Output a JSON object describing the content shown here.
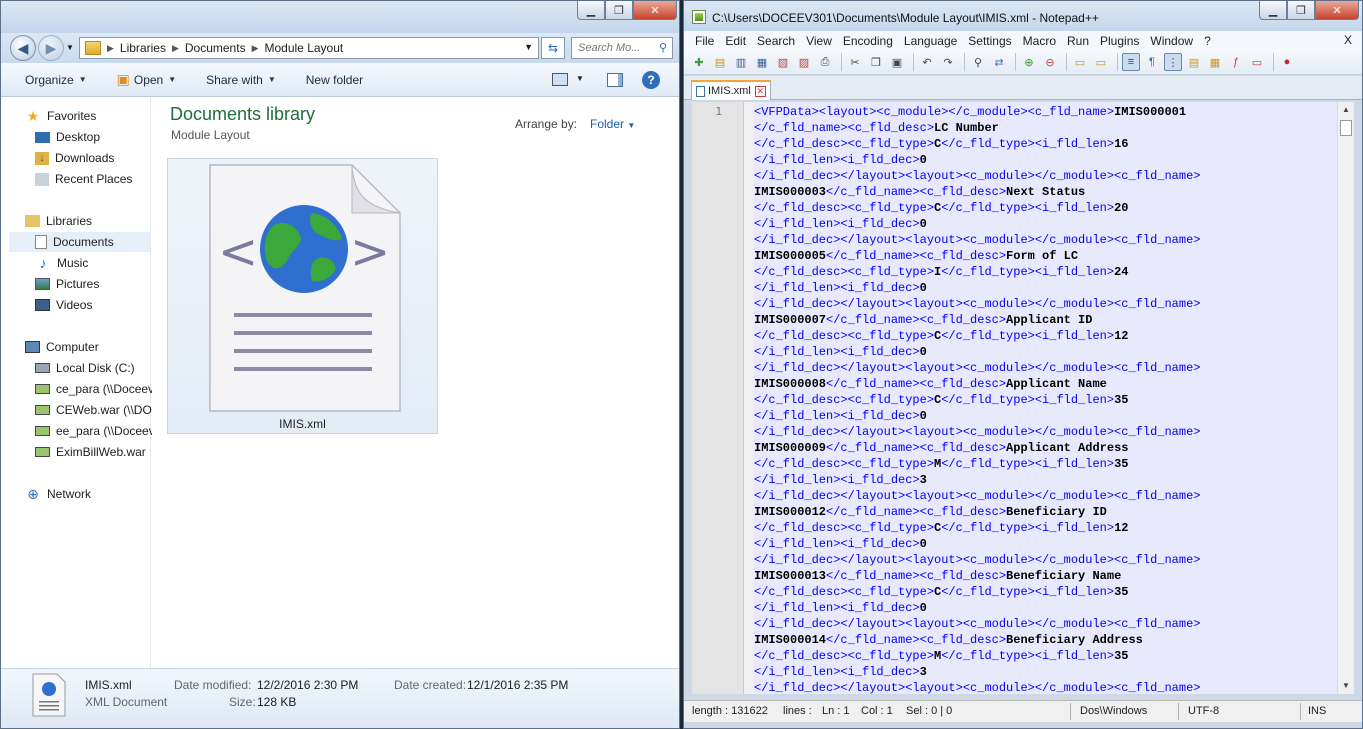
{
  "explorer": {
    "address": [
      "Libraries",
      "Documents",
      "Module Layout"
    ],
    "search_placeholder": "Search Mo...",
    "commands": {
      "organize": "Organize",
      "open": "Open",
      "share": "Share with",
      "new_folder": "New folder"
    },
    "nav": {
      "favorites": "Favorites",
      "desktop": "Desktop",
      "downloads": "Downloads",
      "recent": "Recent Places",
      "libraries": "Libraries",
      "documents": "Documents",
      "music": "Music",
      "pictures": "Pictures",
      "videos": "Videos",
      "computer": "Computer",
      "local_disk": "Local Disk (C:)",
      "ce_para": "ce_para (\\\\Doceev",
      "ceweb": "CEWeb.war (\\\\DO",
      "ee_para": "ee_para (\\\\Doceev",
      "eximbill": "EximBillWeb.war",
      "network": "Network"
    },
    "library_title": "Documents library",
    "library_sub": "Module Layout",
    "arrange_label": "Arrange by:",
    "arrange_value": "Folder",
    "file_name": "IMIS.xml",
    "details": {
      "name": "IMIS.xml",
      "type": "XML Document",
      "modified_label": "Date modified:",
      "modified": "12/2/2016 2:30 PM",
      "created_label": "Date created:",
      "created": "12/1/2016 2:35 PM",
      "size_label": "Size:",
      "size": "128 KB"
    }
  },
  "npp": {
    "title": "C:\\Users\\DOCEEV301\\Documents\\Module Layout\\IMIS.xml - Notepad++",
    "menu": [
      "File",
      "Edit",
      "Search",
      "View",
      "Encoding",
      "Language",
      "Settings",
      "Macro",
      "Run",
      "Plugins",
      "Window",
      "?"
    ],
    "menu_close": "X",
    "tab": "IMIS.xml",
    "line_number": "1",
    "code_lines": [
      [
        [
          "t",
          "<VFPData><layout><c_module></c_module><c_fld_name>"
        ],
        [
          "v",
          "IMIS000001"
        ]
      ],
      [
        [
          "t",
          "</c_fld_name><c_fld_desc>"
        ],
        [
          "v",
          "LC Number"
        ]
      ],
      [
        [
          "t",
          "</c_fld_desc><c_fld_type>"
        ],
        [
          "v",
          "C"
        ],
        [
          "t",
          "</c_fld_type><i_fld_len>"
        ],
        [
          "v",
          "16"
        ]
      ],
      [
        [
          "t",
          "</i_fld_len><i_fld_dec>"
        ],
        [
          "v",
          "0"
        ]
      ],
      [
        [
          "t",
          "</i_fld_dec></layout><layout><c_module></c_module><c_fld_name>"
        ]
      ],
      [
        [
          "v",
          "IMIS000003"
        ],
        [
          "t",
          "</c_fld_name><c_fld_desc>"
        ],
        [
          "v",
          "Next Status"
        ]
      ],
      [
        [
          "t",
          "</c_fld_desc><c_fld_type>"
        ],
        [
          "v",
          "C"
        ],
        [
          "t",
          "</c_fld_type><i_fld_len>"
        ],
        [
          "v",
          "20"
        ]
      ],
      [
        [
          "t",
          "</i_fld_len><i_fld_dec>"
        ],
        [
          "v",
          "0"
        ]
      ],
      [
        [
          "t",
          "</i_fld_dec></layout><layout><c_module></c_module><c_fld_name>"
        ]
      ],
      [
        [
          "v",
          "IMIS000005"
        ],
        [
          "t",
          "</c_fld_name><c_fld_desc>"
        ],
        [
          "v",
          "Form of LC"
        ]
      ],
      [
        [
          "t",
          "</c_fld_desc><c_fld_type>"
        ],
        [
          "v",
          "I"
        ],
        [
          "t",
          "</c_fld_type><i_fld_len>"
        ],
        [
          "v",
          "24"
        ]
      ],
      [
        [
          "t",
          "</i_fld_len><i_fld_dec>"
        ],
        [
          "v",
          "0"
        ]
      ],
      [
        [
          "t",
          "</i_fld_dec></layout><layout><c_module></c_module><c_fld_name>"
        ]
      ],
      [
        [
          "v",
          "IMIS000007"
        ],
        [
          "t",
          "</c_fld_name><c_fld_desc>"
        ],
        [
          "v",
          "Applicant ID"
        ]
      ],
      [
        [
          "t",
          "</c_fld_desc><c_fld_type>"
        ],
        [
          "v",
          "C"
        ],
        [
          "t",
          "</c_fld_type><i_fld_len>"
        ],
        [
          "v",
          "12"
        ]
      ],
      [
        [
          "t",
          "</i_fld_len><i_fld_dec>"
        ],
        [
          "v",
          "0"
        ]
      ],
      [
        [
          "t",
          "</i_fld_dec></layout><layout><c_module></c_module><c_fld_name>"
        ]
      ],
      [
        [
          "v",
          "IMIS000008"
        ],
        [
          "t",
          "</c_fld_name><c_fld_desc>"
        ],
        [
          "v",
          "Applicant Name"
        ]
      ],
      [
        [
          "t",
          "</c_fld_desc><c_fld_type>"
        ],
        [
          "v",
          "C"
        ],
        [
          "t",
          "</c_fld_type><i_fld_len>"
        ],
        [
          "v",
          "35"
        ]
      ],
      [
        [
          "t",
          "</i_fld_len><i_fld_dec>"
        ],
        [
          "v",
          "0"
        ]
      ],
      [
        [
          "t",
          "</i_fld_dec></layout><layout><c_module></c_module><c_fld_name>"
        ]
      ],
      [
        [
          "v",
          "IMIS000009"
        ],
        [
          "t",
          "</c_fld_name><c_fld_desc>"
        ],
        [
          "v",
          "Applicant Address"
        ]
      ],
      [
        [
          "t",
          "</c_fld_desc><c_fld_type>"
        ],
        [
          "v",
          "M"
        ],
        [
          "t",
          "</c_fld_type><i_fld_len>"
        ],
        [
          "v",
          "35"
        ]
      ],
      [
        [
          "t",
          "</i_fld_len><i_fld_dec>"
        ],
        [
          "v",
          "3"
        ]
      ],
      [
        [
          "t",
          "</i_fld_dec></layout><layout><c_module></c_module><c_fld_name>"
        ]
      ],
      [
        [
          "v",
          "IMIS000012"
        ],
        [
          "t",
          "</c_fld_name><c_fld_desc>"
        ],
        [
          "v",
          "Beneficiary ID"
        ]
      ],
      [
        [
          "t",
          "</c_fld_desc><c_fld_type>"
        ],
        [
          "v",
          "C"
        ],
        [
          "t",
          "</c_fld_type><i_fld_len>"
        ],
        [
          "v",
          "12"
        ]
      ],
      [
        [
          "t",
          "</i_fld_len><i_fld_dec>"
        ],
        [
          "v",
          "0"
        ]
      ],
      [
        [
          "t",
          "</i_fld_dec></layout><layout><c_module></c_module><c_fld_name>"
        ]
      ],
      [
        [
          "v",
          "IMIS000013"
        ],
        [
          "t",
          "</c_fld_name><c_fld_desc>"
        ],
        [
          "v",
          "Beneficiary Name"
        ]
      ],
      [
        [
          "t",
          "</c_fld_desc><c_fld_type>"
        ],
        [
          "v",
          "C"
        ],
        [
          "t",
          "</c_fld_type><i_fld_len>"
        ],
        [
          "v",
          "35"
        ]
      ],
      [
        [
          "t",
          "</i_fld_len><i_fld_dec>"
        ],
        [
          "v",
          "0"
        ]
      ],
      [
        [
          "t",
          "</i_fld_dec></layout><layout><c_module></c_module><c_fld_name>"
        ]
      ],
      [
        [
          "v",
          "IMIS000014"
        ],
        [
          "t",
          "</c_fld_name><c_fld_desc>"
        ],
        [
          "v",
          "Beneficiary Address"
        ]
      ],
      [
        [
          "t",
          "</c_fld_desc><c_fld_type>"
        ],
        [
          "v",
          "M"
        ],
        [
          "t",
          "</c_fld_type><i_fld_len>"
        ],
        [
          "v",
          "35"
        ]
      ],
      [
        [
          "t",
          "</i_fld_len><i_fld_dec>"
        ],
        [
          "v",
          "3"
        ]
      ],
      [
        [
          "t",
          "</i_fld_dec></layout><layout><c_module></c_module><c_fld_name>"
        ]
      ]
    ],
    "status": {
      "length": "length : 131622",
      "lines": "lines :",
      "ln": "Ln : 1",
      "col": "Col : 1",
      "sel": "Sel : 0 | 0",
      "eol": "Dos\\Windows",
      "encoding": "UTF-8",
      "mode": "INS"
    }
  }
}
